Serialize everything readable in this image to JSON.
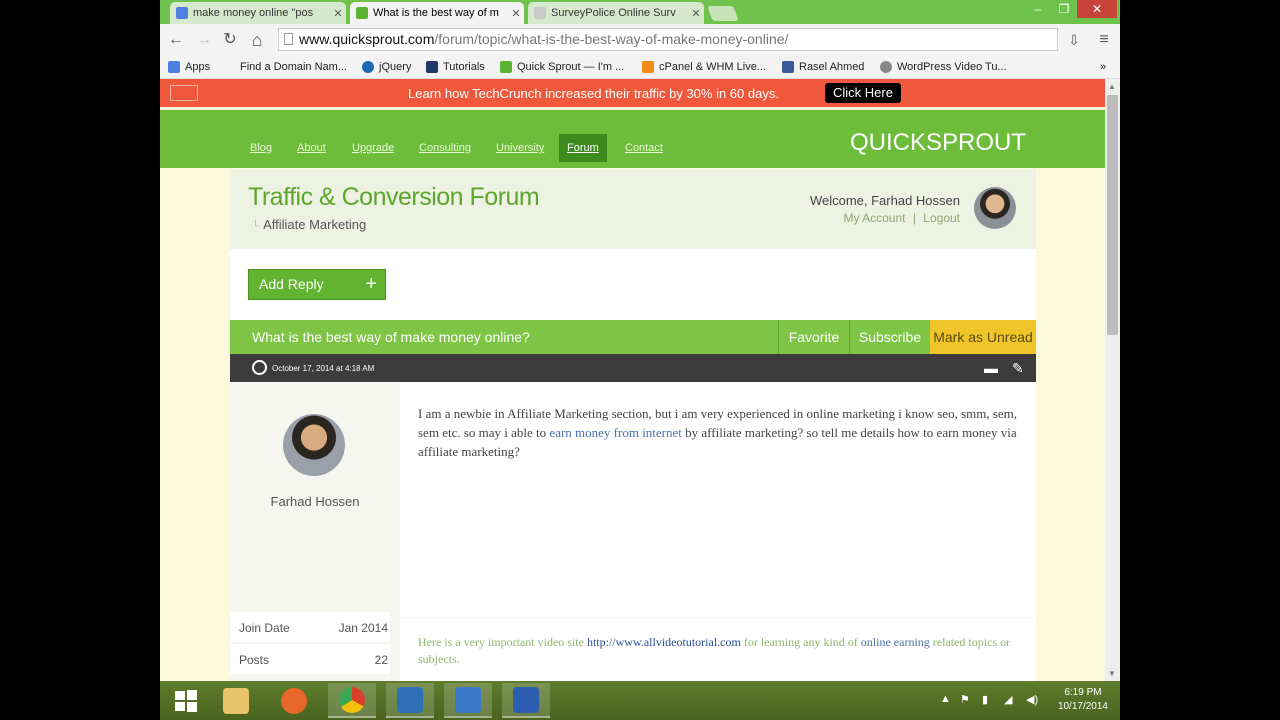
{
  "browser": {
    "tabs": [
      {
        "label": "make money online \"pos",
        "favicon_color": "#4f7fe0",
        "active": false
      },
      {
        "label": "What is the best way of m",
        "favicon_color": "#5bb533",
        "active": true
      },
      {
        "label": "SurveyPolice Online Surv",
        "favicon_color": "#c9c9c9",
        "active": false
      }
    ],
    "tab_close": "✕",
    "window_controls": {
      "minimize": "–",
      "maximize": "❐",
      "close": "✕"
    },
    "nav": {
      "back": "←",
      "forward": "→",
      "reload": "↻",
      "home": "⌂"
    },
    "url_host": "www.quicksprout.com",
    "url_path": "/forum/topic/what-is-the-best-way-of-make-money-online/",
    "bookmarks": [
      {
        "label": "Apps",
        "icon_color": "#4a7ee0"
      },
      {
        "label": "Find a Domain Nam...",
        "icon_color": "#f3f3f3"
      },
      {
        "label": "jQuery",
        "icon_color": "#1b68b4"
      },
      {
        "label": "Tutorials",
        "icon_color": "#1f3a66"
      },
      {
        "label": "Quick Sprout — I'm ...",
        "icon_color": "#5bb533"
      },
      {
        "label": "cPanel & WHM Live...",
        "icon_color": "#f28a1b"
      },
      {
        "label": "Rasel Ahmed",
        "icon_color": "#3b5998"
      },
      {
        "label": "WordPress Video Tu...",
        "icon_color": "#888888"
      }
    ],
    "bookmarks_more": "»"
  },
  "promo": {
    "text": "Learn how TechCrunch increased their traffic by 30% in 60 days.",
    "cta": "Click Here"
  },
  "site": {
    "brand": "QUICKSPROUT",
    "nav_items": [
      "Blog",
      "About",
      "Upgrade",
      "Consulting",
      "University",
      "Forum",
      "Contact"
    ],
    "active_nav": "Forum"
  },
  "forum": {
    "title": "Traffic & Conversion Forum",
    "category": "Affiliate Marketing",
    "category_prefix": "└",
    "welcome": "Welcome, Farhad Hossen",
    "my_account": "My Account",
    "separator": "|",
    "logout": "Logout",
    "add_reply": "Add Reply",
    "add_reply_plus": "+"
  },
  "topic": {
    "title": "What is the best way of make money online?",
    "favorite": "Favorite",
    "subscribe": "Subscribe",
    "mark_unread": "Mark as Unread",
    "date": "October 17, 2014 at 4:18 AM"
  },
  "post": {
    "author": "Farhad Hossen",
    "stats": [
      {
        "label": "Join Date",
        "value": "Jan 2014"
      },
      {
        "label": "Posts",
        "value": "22"
      }
    ],
    "body_before": "I am a newbie in Affiliate Marketing section, but i am very experienced in online marketing i know seo, smm, sem, sem etc. so may i able to ",
    "body_link": "earn money from internet",
    "body_after": " by affiliate marketing? so tell me details how to earn money via affiliate marketing?",
    "sig_before": "Here is a very important video site ",
    "sig_url": "http://www.allvideotutorial.com",
    "sig_middle": " for learning any kind of ",
    "sig_link": "online earning",
    "sig_after": " related topics or subjects."
  },
  "taskbar": {
    "time": "6:19 PM",
    "date": "10/17/2014",
    "apps": [
      {
        "name": "start",
        "color": "#ffffff"
      },
      {
        "name": "file-explorer",
        "color": "#e7c46a"
      },
      {
        "name": "firefox",
        "color": "#e8672a"
      },
      {
        "name": "chrome",
        "color": "#d9402c"
      },
      {
        "name": "monitor-app",
        "color": "#2f6fb5"
      },
      {
        "name": "save-app",
        "color": "#3c78c8"
      },
      {
        "name": "word",
        "color": "#2b5eb0"
      }
    ]
  }
}
